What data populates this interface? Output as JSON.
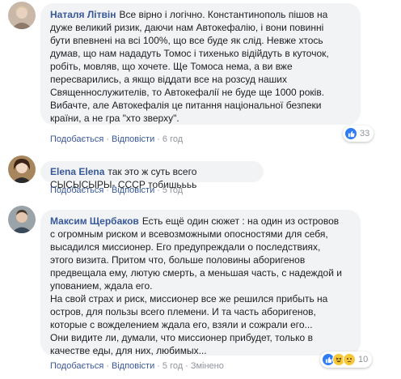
{
  "comments": [
    {
      "author": "Наталя Літвін",
      "text": "Все вірно і логічно. Константинополь пішов на\nдуже великий ризик, даючи нам Автокефалію, і вони повинні\nбути впевнені на всі 100%, що все буде як слід. Невже хтось\nдумав, що нам нададуть Томос і тихенько відійдуть в куточок,\nробіть, мовляв, що хочете. Ще Томоса нема, а ви вже\nпересварились, а якщо віддати все на розсуд наших\nСвященнослужителів, то Автокефалії не буде ще 1000 років.\nВибачте, але Автокефалія це питання національної безпеки\nкраїни, а не гра \"хто зверху\".",
      "like_label": "Подобається",
      "reply_label": "Відповісти",
      "time": "6 год",
      "reactions": {
        "icons": [
          "like-icon"
        ],
        "count": "33"
      }
    },
    {
      "author": "Elena Elena",
      "text": "так это ж суть всего СЫСЫСЫРЫ- СССР тобишьььь",
      "like_label": "Подобається",
      "reply_label": "Відповісти",
      "time": "5 год"
    },
    {
      "author": "Максим Щербаков",
      "text": "Есть ещё один сюжет : на один из островов\nс огромным риском и всевозможными опосностями для себя,\nвысадился миссионер. Его предупреждали о последствиях,\nэтого визита. Притом что, больше половины аборигенов\nпредвещала ему, лютую смерть, а меньшая часть, с надеждой и\nупованием, ждала его.\nНа свой страх и риск, миссионер все же решился прибыть на\nостров, для пользы всего племени. И та часть аборигенов,\nкоторые с вожделением ждала его, взяли и сожрали его...\nОни видите ли, думали, что миссионер прибудет, только в\nкачестве еды, для них, любимых...",
      "like_label": "Подобається",
      "reply_label": "Відповісти",
      "time": "5 год",
      "edited": "Змінено",
      "reactions": {
        "icons": [
          "like-icon",
          "haha-icon",
          "sad-icon"
        ],
        "count": "10"
      }
    }
  ],
  "colors": {
    "link": "#385898",
    "muted": "#90949c",
    "bubble": "#f2f3f5",
    "like": "#2f7df6"
  }
}
